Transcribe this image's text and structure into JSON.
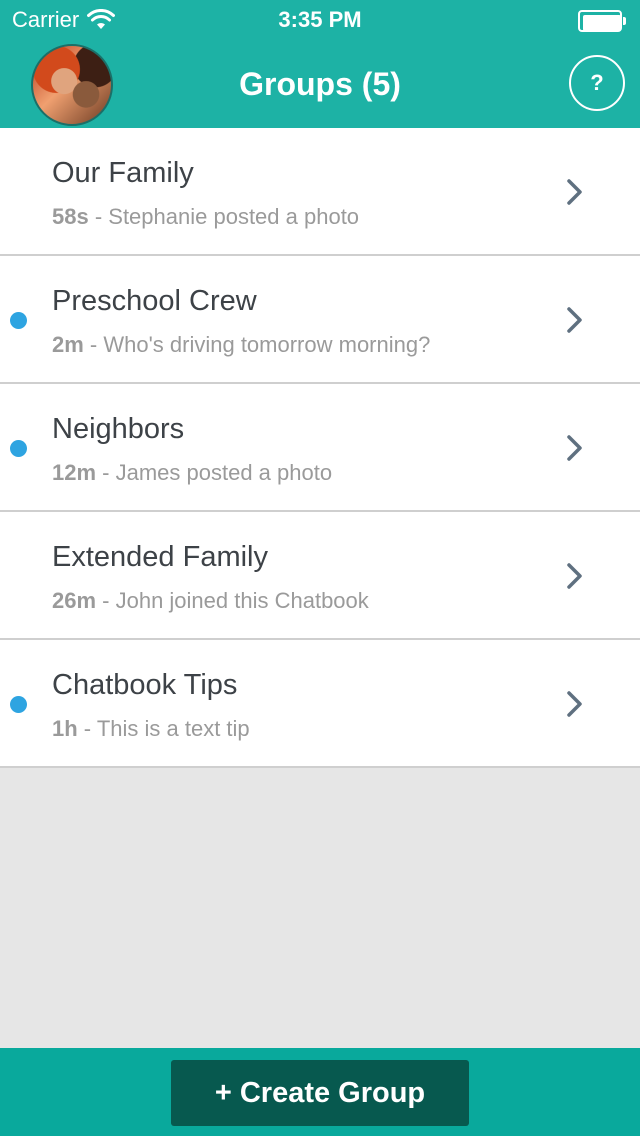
{
  "status_bar": {
    "carrier": "Carrier",
    "time": "3:35 PM"
  },
  "nav": {
    "title": "Groups (5)",
    "help_label": "?"
  },
  "groups": [
    {
      "name": "Our Family",
      "time": "58s",
      "activity": " - Stephanie posted a photo",
      "unread": false
    },
    {
      "name": "Preschool Crew",
      "time": "2m",
      "activity": " - Who's driving tomorrow morning?",
      "unread": true
    },
    {
      "name": "Neighbors",
      "time": "12m",
      "activity": " - James posted a photo",
      "unread": true
    },
    {
      "name": "Extended Family",
      "time": "26m",
      "activity": " - John joined this Chatbook",
      "unread": false
    },
    {
      "name": "Chatbook Tips",
      "time": "1h",
      "activity": " - This is a text tip",
      "unread": true
    }
  ],
  "footer": {
    "create_label": "+ Create Group"
  },
  "colors": {
    "header": "#1db2a5",
    "footer": "#09a99c",
    "create_button": "#07594f",
    "unread_dot": "#2ea4e1",
    "chevron": "#5f7080"
  },
  "icons": {
    "wifi": "wifi-icon",
    "battery": "battery-icon",
    "chevron": "chevron-right-icon",
    "help": "question-mark-icon"
  }
}
